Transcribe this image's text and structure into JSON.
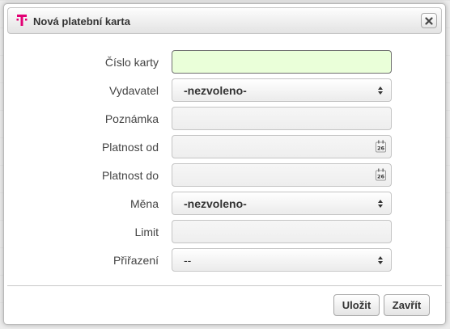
{
  "dialog": {
    "title": "Nová platební karta",
    "brand_color": "#e20074"
  },
  "form": {
    "card_number": {
      "label": "Číslo karty",
      "value": ""
    },
    "issuer": {
      "label": "Vydavatel",
      "value": "-nezvoleno-"
    },
    "note": {
      "label": "Poznámka",
      "value": ""
    },
    "valid_from": {
      "label": "Platnost od",
      "value": ""
    },
    "valid_to": {
      "label": "Platnost do",
      "value": ""
    },
    "currency": {
      "label": "Měna",
      "value": "-nezvoleno-"
    },
    "limit": {
      "label": "Limit",
      "value": ""
    },
    "assignment": {
      "label": "Přiřazení",
      "value": "--"
    }
  },
  "calendar_icon_day": "26",
  "buttons": {
    "save": "Uložit",
    "close": "Zavřít"
  }
}
